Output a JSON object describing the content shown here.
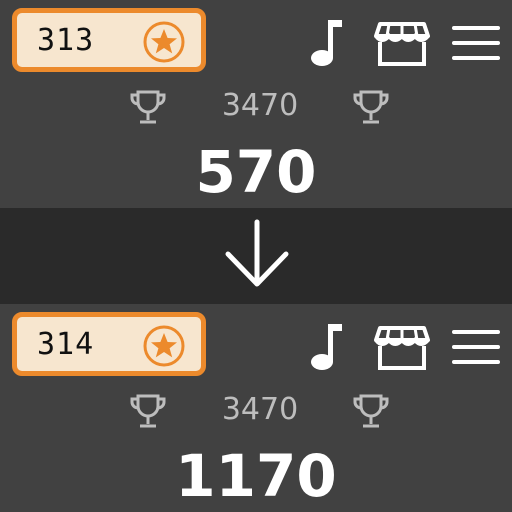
{
  "before": {
    "coins": "313",
    "best": "3470",
    "score": "570"
  },
  "after": {
    "coins": "314",
    "best": "3470",
    "score": "1170"
  },
  "icons": {
    "coin": "star-coin-icon",
    "music": "music-note-icon",
    "shop": "shop-storefront-icon",
    "menu": "hamburger-menu-icon",
    "best": "trophy-icon",
    "transition": "down-arrow-icon"
  },
  "colors": {
    "accent": "#ec8a2c",
    "badge_bg": "#f7e6cf",
    "panel_bg": "#414141",
    "divider_bg": "#2a2a2a",
    "best_text": "#bdbdbd",
    "score_text": "#ffffff"
  }
}
